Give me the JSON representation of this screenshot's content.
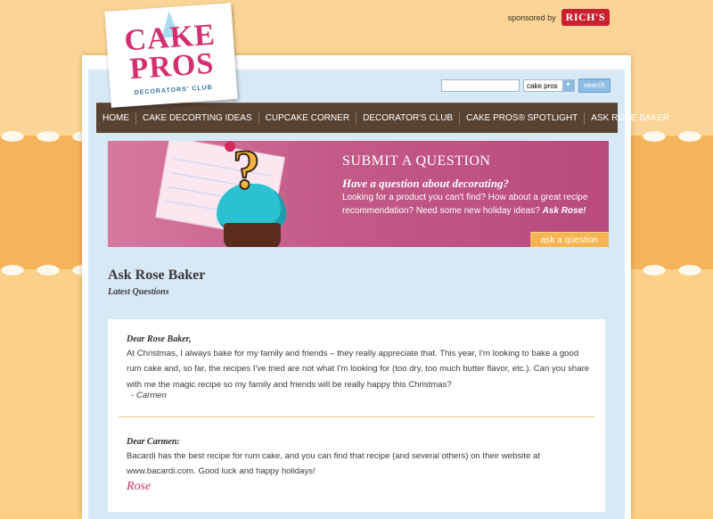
{
  "sponsor": {
    "label": "sponsored by",
    "brand": "RICH'S"
  },
  "logo": {
    "line1": "CAKE",
    "line2": "PROS",
    "tagline": "DECORATORS' CLUB"
  },
  "search": {
    "placeholder": "",
    "select_value": "cake pros",
    "button": "search"
  },
  "nav": [
    "HOME",
    "CAKE DECORTING IDEAS",
    "CUPCAKE CORNER",
    "DECORATOR'S CLUB",
    "CAKE PROS® SPOTLIGHT",
    "ASK ROSE BAKER"
  ],
  "banner": {
    "title": "SUBMIT A QUESTION",
    "subtitle": "Have a question about decorating?",
    "body": "Looking for a product you can't find? How about a great recipe recommendation? Need some new holiday ideas?",
    "body_emph": "Ask Rose!",
    "button": "ask a question"
  },
  "page": {
    "title": "Ask Rose Baker",
    "subtitle": "Latest Questions"
  },
  "question": {
    "greeting": "Dear Rose Baker,",
    "text": "At Christmas, I always bake for my family and friends – they really appreciate that. This year, I'm looking to bake a good rum cake and, so far, the recipes I've tried are not what I'm looking for (too dry, too much butter flavor, etc.). Can you share with me the magic recipe so my family and friends will be really happy this Christmas?",
    "signature": "- Carmen"
  },
  "answer": {
    "greeting": "Dear Carmen:",
    "text": "Bacardi has the best recipe for rum cake, and you can find that recipe (and several others) on their website at www.bacardi.com. Good luck and happy holidays!",
    "signature": "Rose"
  },
  "colors": {
    "nav_bg": "#584232",
    "accent_pink": "#c35a86",
    "button_orange": "#f6b552",
    "panel_blue": "#d8e9f6"
  }
}
